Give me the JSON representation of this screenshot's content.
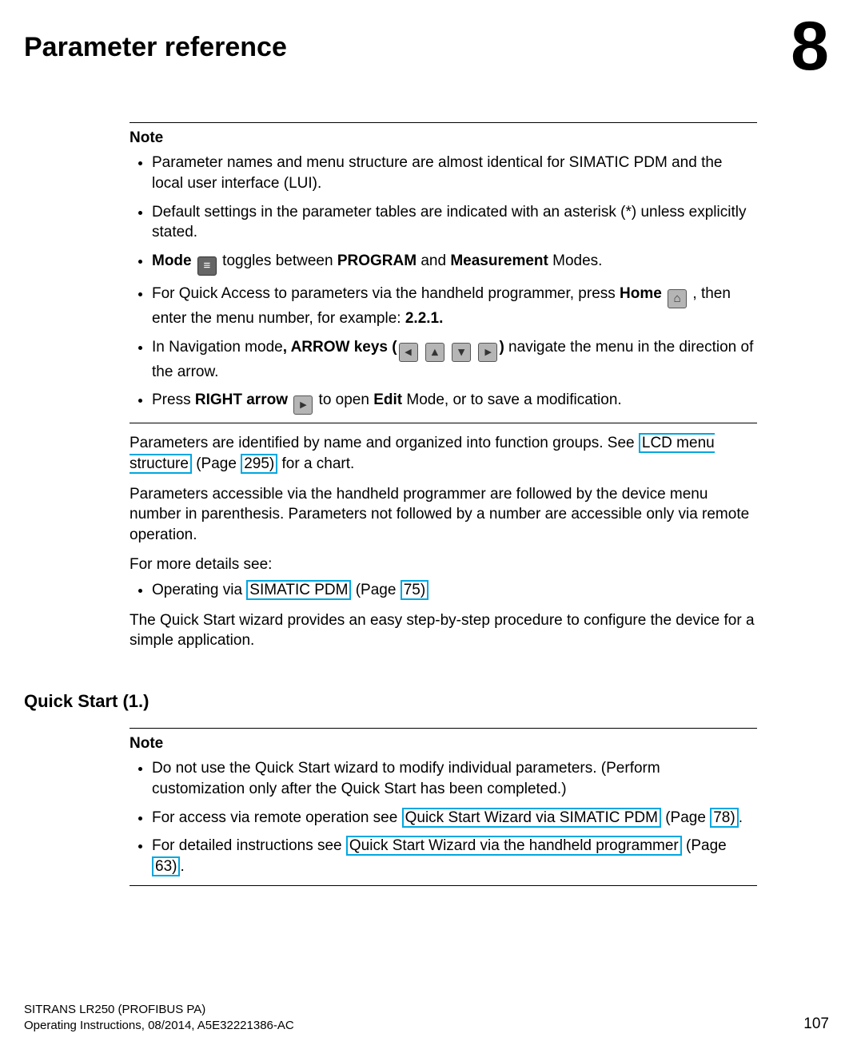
{
  "header": {
    "chapter_title": "Parameter reference",
    "chapter_number": "8"
  },
  "note1": {
    "label": "Note",
    "item1": "Parameter names and menu structure are almost identical for SIMATIC PDM and the local user interface (LUI).",
    "item2": "Default settings in the parameter tables are indicated with an asterisk (*) unless explicitly stated.",
    "item3_pre": "Mode ",
    "item3_mid": " toggles between ",
    "item3_prog": "PROGRAM",
    "item3_and": " and ",
    "item3_meas": "Measurement",
    "item3_post": " Modes.",
    "item4_pre": "For Quick Access to parameters via the handheld programmer, press ",
    "item4_home": "Home",
    "item4_mid": " , then enter the menu number, for example: ",
    "item4_menu": "2.2.1.",
    "item5_pre": "In Navigation mode",
    "item5_keys": ", ARROW keys (",
    "item5_close": ")",
    "item5_post": " navigate the menu in the direction of the arrow.",
    "item6_pre": "Press ",
    "item6_right": "RIGHT arrow ",
    "item6_mid": " to open ",
    "item6_edit": "Edit",
    "item6_post": " Mode, or to save a modification."
  },
  "body": {
    "p1_pre": "Parameters are identified by name and organized into function groups. See ",
    "p1_link1": "LCD menu structure",
    "p1_mid": " (Page ",
    "p1_link2": "295)",
    "p1_post": " for a chart.",
    "p2": "Parameters accessible via the handheld programmer are followed by the device menu number in parenthesis. Parameters not followed by a number are accessible only via remote operation.",
    "p3": "For more details see:",
    "bullet_pre": "Operating via ",
    "bullet_link1": "SIMATIC PDM",
    "bullet_mid": " (Page ",
    "bullet_link2": "75)",
    "p4": "The Quick Start wizard provides an easy step-by-step procedure to configure the device for a simple application."
  },
  "section2": {
    "heading": "Quick Start (1.)",
    "note_label": "Note",
    "item1": "Do not use the Quick Start wizard to modify individual parameters. (Perform customization only after the Quick Start has been completed.)",
    "item2_pre": "For access via remote operation see ",
    "item2_link1": "Quick Start Wizard via SIMATIC PDM",
    "item2_mid": " (Page ",
    "item2_link2": "78)",
    "item2_post": ".",
    "item3_pre": "For detailed instructions see ",
    "item3_link1": "Quick Start Wizard via the handheld programmer",
    "item3_mid": " (Page ",
    "item3_link2": "63)",
    "item3_post": "."
  },
  "footer": {
    "line1": "SITRANS LR250 (PROFIBUS PA)",
    "line2": "Operating Instructions, 08/2014, A5E32221386-AC",
    "page": "107"
  }
}
